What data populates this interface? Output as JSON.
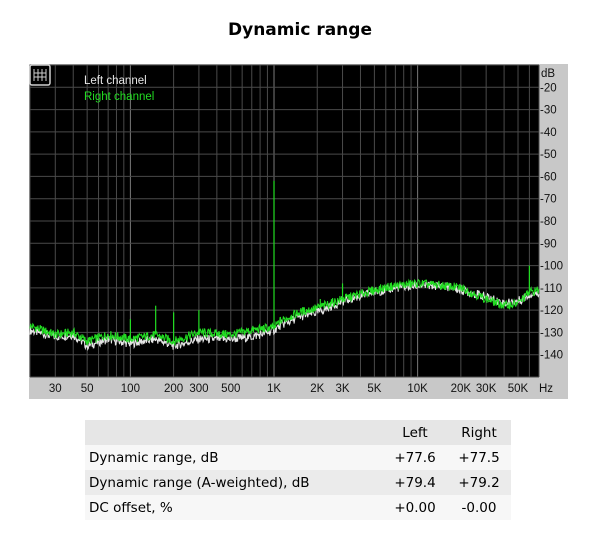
{
  "title": "Dynamic range",
  "chart_data": {
    "type": "line",
    "title": "Dynamic range",
    "xlabel": "",
    "ylabel": "",
    "x_scale": "log",
    "xlim": [
      20,
      70000
    ],
    "ylim": [
      -150,
      -10
    ],
    "x_unit": "Hz",
    "y_unit": "dB",
    "x_ticks": [
      {
        "value": 30,
        "label": "30"
      },
      {
        "value": 50,
        "label": "50"
      },
      {
        "value": 100,
        "label": "100"
      },
      {
        "value": 200,
        "label": "200"
      },
      {
        "value": 300,
        "label": "300"
      },
      {
        "value": 500,
        "label": "500"
      },
      {
        "value": 1000,
        "label": "1K"
      },
      {
        "value": 2000,
        "label": "2K"
      },
      {
        "value": 3000,
        "label": "3K"
      },
      {
        "value": 5000,
        "label": "5K"
      },
      {
        "value": 10000,
        "label": "10K"
      },
      {
        "value": 20000,
        "label": "20K"
      },
      {
        "value": 30000,
        "label": "30K"
      },
      {
        "value": 50000,
        "label": "50K"
      }
    ],
    "y_ticks": [
      -20,
      -30,
      -40,
      -50,
      -60,
      -70,
      -80,
      -90,
      -100,
      -110,
      -120,
      -130,
      -140
    ],
    "grid": true,
    "legend": "top-left",
    "background": "#000000",
    "series": [
      {
        "name": "Left channel",
        "color": "#e6e6e6",
        "x": [
          20,
          30,
          40,
          50,
          70,
          100,
          150,
          200,
          300,
          500,
          700,
          900,
          1000,
          1100,
          1500,
          2000,
          3000,
          5000,
          7000,
          10000,
          15000,
          20000,
          30000,
          40000,
          50000,
          60000,
          70000
        ],
        "y": [
          -129,
          -132,
          -131,
          -136,
          -133,
          -135,
          -133,
          -136,
          -133,
          -133,
          -132,
          -130,
          -129,
          -127,
          -123,
          -121,
          -116,
          -112,
          -110,
          -109,
          -109,
          -111,
          -114,
          -117,
          -116,
          -113,
          -112
        ]
      },
      {
        "name": "Right channel",
        "color": "#22dd22",
        "x": [
          20,
          30,
          40,
          50,
          70,
          100,
          150,
          200,
          300,
          500,
          700,
          900,
          1000,
          1100,
          1500,
          2000,
          3000,
          5000,
          7000,
          10000,
          15000,
          20000,
          30000,
          40000,
          50000,
          60000,
          70000
        ],
        "y": [
          -127,
          -131,
          -130,
          -134,
          -131,
          -133,
          -131,
          -134,
          -130,
          -131,
          -129,
          -128,
          -128,
          -125,
          -121,
          -119,
          -115,
          -111,
          -109,
          -108,
          -109,
          -110,
          -115,
          -118,
          -117,
          -112,
          -111
        ]
      }
    ],
    "peaks": [
      {
        "series": 1,
        "x": 1000,
        "y": -62
      },
      {
        "series": 1,
        "x": 60000,
        "y": -100
      },
      {
        "series": 1,
        "x": 150,
        "y": -118
      },
      {
        "series": 1,
        "x": 100,
        "y": -124
      },
      {
        "series": 1,
        "x": 200,
        "y": -121
      },
      {
        "series": 1,
        "x": 300,
        "y": -120
      },
      {
        "series": 1,
        "x": 2100,
        "y": -115
      },
      {
        "series": 1,
        "x": 3000,
        "y": -108
      }
    ]
  },
  "table": {
    "headers": [
      "",
      "Left",
      "Right"
    ],
    "rows": [
      {
        "label": "Dynamic range, dB",
        "left": "+77.6",
        "right": "+77.5"
      },
      {
        "label": "Dynamic range (A-weighted), dB",
        "left": "+79.4",
        "right": "+79.2"
      },
      {
        "label": "DC offset, %",
        "left": "+0.00",
        "right": "-0.00"
      }
    ]
  }
}
